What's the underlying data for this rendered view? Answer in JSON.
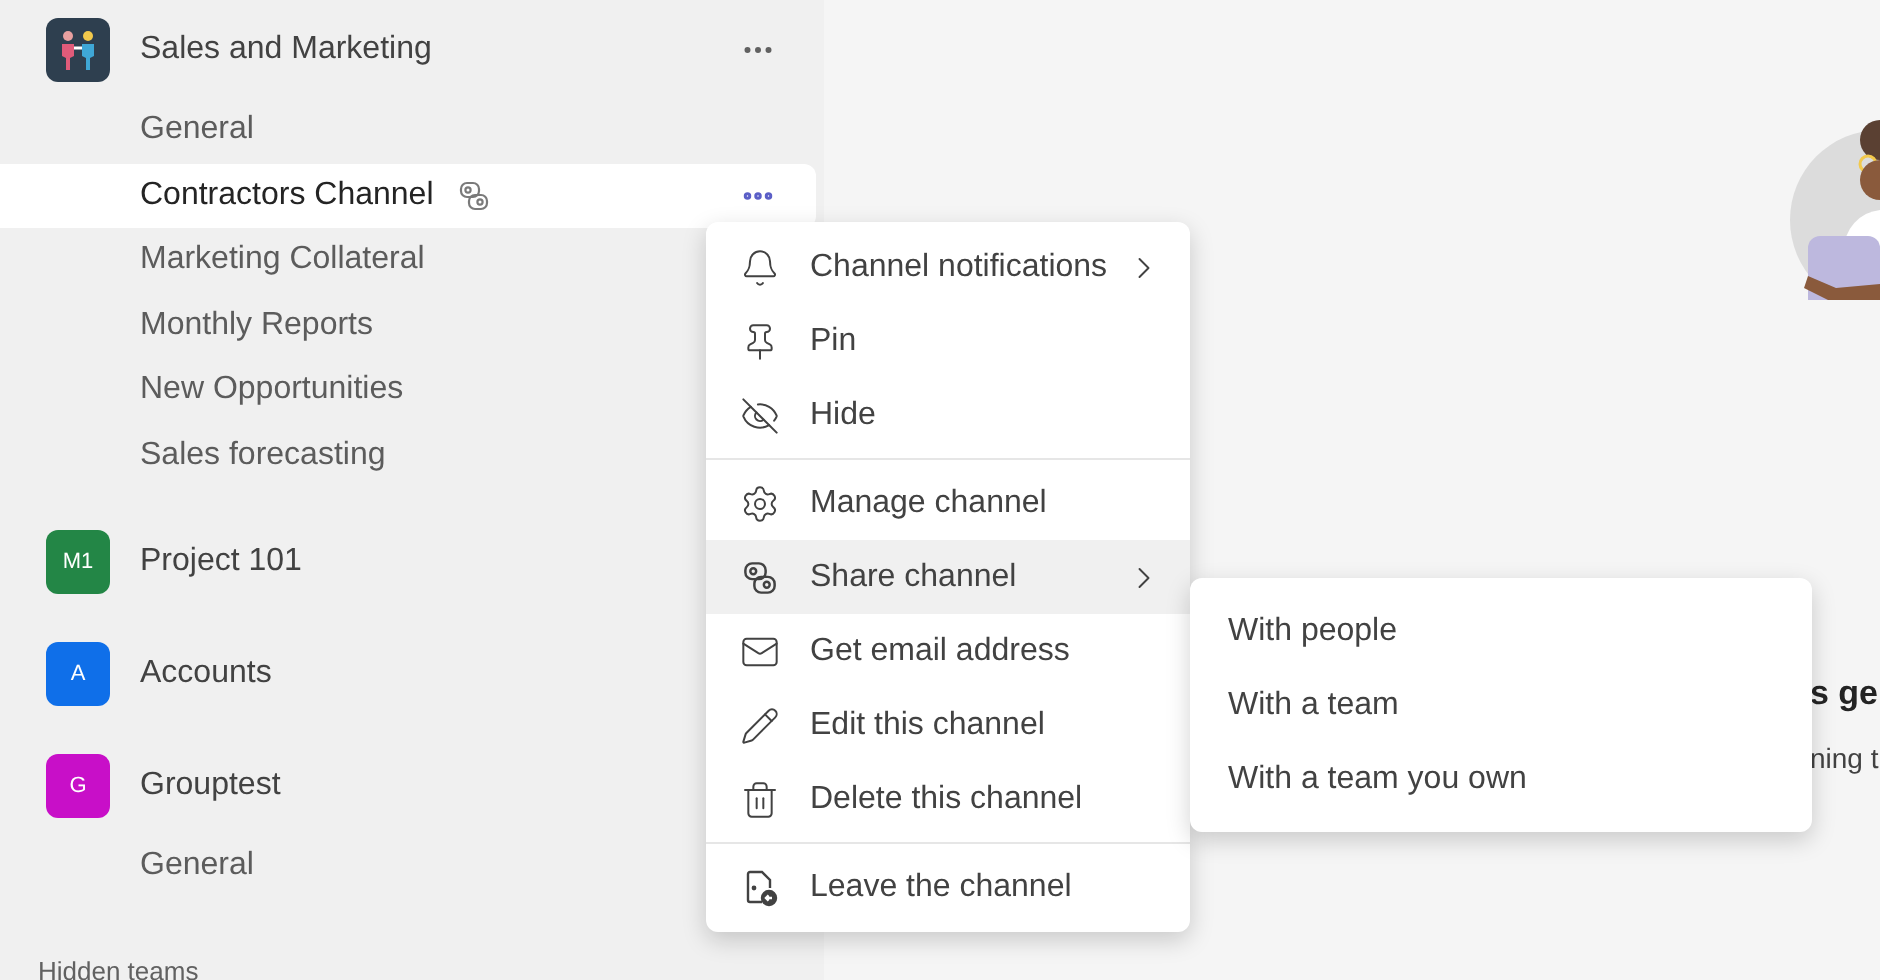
{
  "sidebar": {
    "teams": [
      {
        "name": "Sales and Marketing",
        "more": true,
        "channels": [
          {
            "name": "General",
            "selected": false,
            "shared": false
          },
          {
            "name": "Contractors Channel",
            "selected": true,
            "shared": true
          },
          {
            "name": "Marketing Collateral",
            "selected": false,
            "shared": false
          },
          {
            "name": "Monthly Reports",
            "selected": false,
            "shared": false
          },
          {
            "name": "New Opportunities",
            "selected": false,
            "shared": false
          },
          {
            "name": "Sales forecasting",
            "selected": false,
            "shared": false
          }
        ]
      },
      {
        "name": "Project 101",
        "avatar": {
          "kind": "initials",
          "initials": "M1",
          "color": "#238646"
        },
        "more": false
      },
      {
        "name": "Accounts",
        "avatar": {
          "kind": "initials",
          "initials": "A",
          "color": "#0f6fe9"
        },
        "more": false
      },
      {
        "name": "Grouptest",
        "avatar": {
          "kind": "initials",
          "initials": "G",
          "color": "#c80fc8"
        },
        "more": false,
        "channels": [
          {
            "name": "General",
            "selected": false,
            "shared": false
          }
        ]
      }
    ],
    "footer": "Hidden teams"
  },
  "main": {
    "heading": "s ge",
    "text": "ning t"
  },
  "menu": {
    "sections": [
      {
        "items": [
          {
            "label": "Channel notifications",
            "kind": "bell",
            "submenu": true,
            "selected": false
          },
          {
            "label": "Pin",
            "kind": "pin",
            "submenu": false,
            "selected": false
          },
          {
            "label": "Hide",
            "kind": "hide",
            "submenu": false,
            "selected": false
          }
        ]
      },
      {
        "items": [
          {
            "label": "Manage channel",
            "kind": "gear",
            "submenu": false,
            "selected": false
          },
          {
            "label": "Share channel",
            "kind": "share",
            "submenu": true,
            "selected": true
          },
          {
            "label": "Get email address",
            "kind": "mail",
            "submenu": false,
            "selected": false
          },
          {
            "label": "Edit this channel",
            "kind": "pencil",
            "submenu": false,
            "selected": false
          },
          {
            "label": "Delete this channel",
            "kind": "trash",
            "submenu": false,
            "selected": false
          }
        ]
      },
      {
        "items": [
          {
            "label": "Leave the channel",
            "kind": "leave",
            "submenu": false,
            "selected": false
          }
        ]
      }
    ]
  },
  "submenu": {
    "items": [
      {
        "label": "With people"
      },
      {
        "label": "With a team"
      },
      {
        "label": "With a team you own"
      }
    ]
  }
}
